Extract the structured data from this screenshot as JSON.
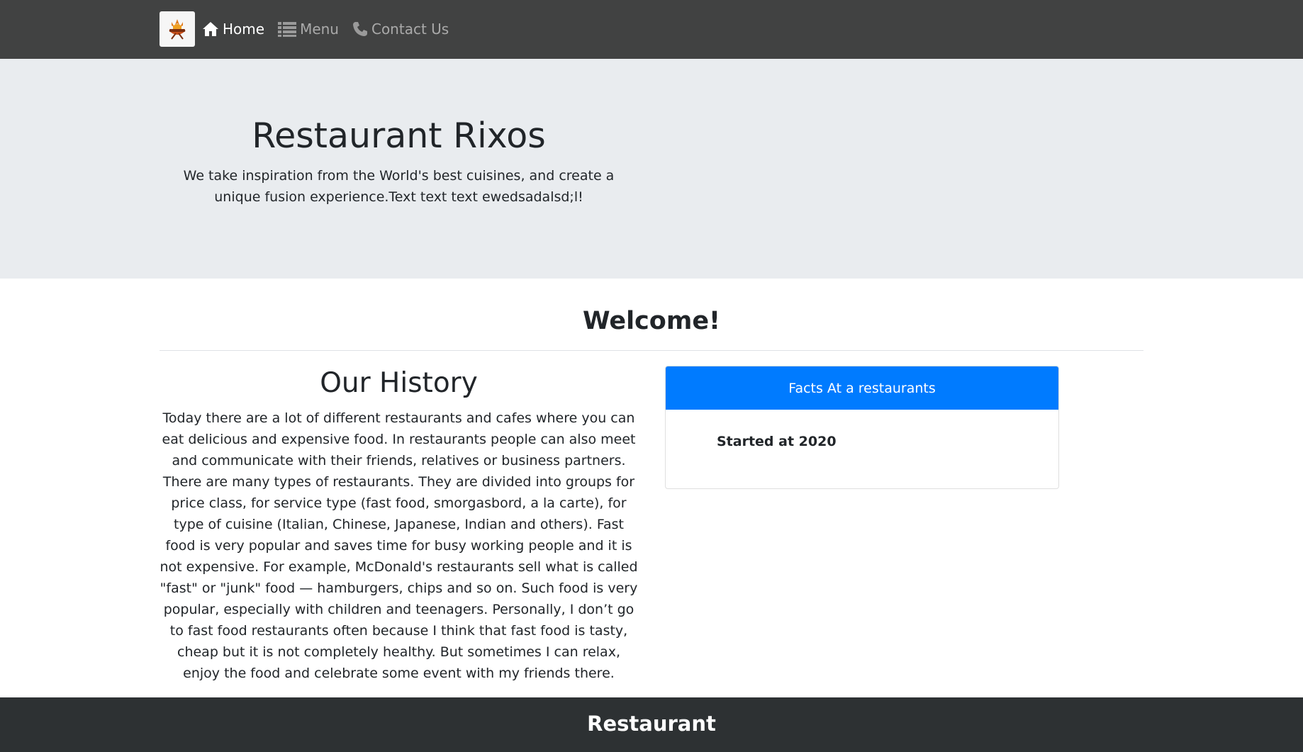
{
  "nav": {
    "logo_icon": "restaurant-logo-icon",
    "items": [
      {
        "label": "Home",
        "icon": "home-icon",
        "active": true
      },
      {
        "label": "Menu",
        "icon": "list-icon",
        "active": false
      },
      {
        "label": "Contact Us",
        "icon": "phone-icon",
        "active": false
      }
    ]
  },
  "hero": {
    "title": "Restaurant Rixos",
    "text": "We take inspiration from the World's best cuisines, and create a unique fusion experience.Text text text ewedsadalsd;l!"
  },
  "welcome": {
    "title": "Welcome!"
  },
  "history": {
    "title": "Our History",
    "text": "Today there are a lot of different restaurants and cafes where you can eat delicious and expensive food. In restaurants people can also meet and communicate with their friends, relatives or business partners. There are many types of restaurants. They are divided into groups for price class, for service type (fast food, smorgasbord, a la carte), for type of cuisine (Italian, Chinese, Japanese, Indian and others). Fast food is very popular and saves time for busy working people and it is not expensive. For example, McDonald's restaurants sell what is called \"fast\" or \"junk\" food — hamburgers, chips and so on. Such food is very popular, especially with children and teenagers. Personally, I don’t go to fast food restaurants often because I think that fast food is tasty, cheap but it is not completely healthy. But sometimes I can relax, enjoy the food and celebrate some event with my friends there."
  },
  "facts": {
    "header": "Facts At a restaurants",
    "items": [
      "Started at 2020"
    ]
  },
  "footer": {
    "title": "Restaurant"
  },
  "colors": {
    "navbar": "#414242",
    "jumbotron": "#e9ecef",
    "card_header": "#007bff",
    "footer": "#2d3133"
  }
}
